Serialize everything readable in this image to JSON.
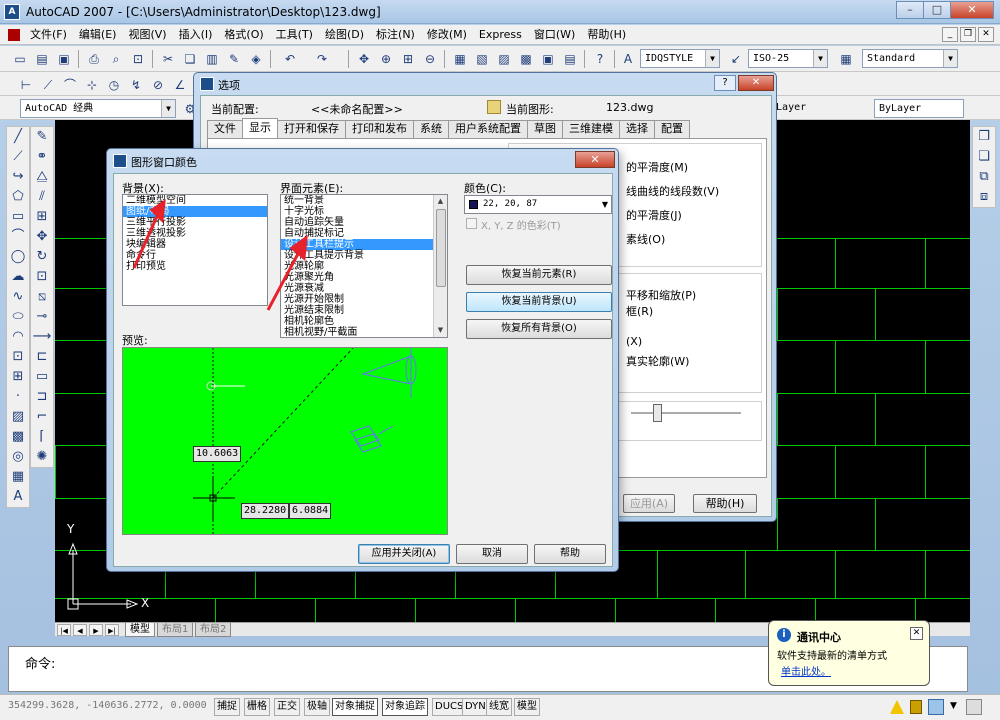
{
  "window": {
    "title": "AutoCAD 2007 - [C:\\Users\\Administrator\\Desktop\\123.dwg]",
    "controls": [
      "–",
      "□",
      "✕"
    ]
  },
  "menubar": {
    "items": [
      "文件(F)",
      "编辑(E)",
      "视图(V)",
      "插入(I)",
      "格式(O)",
      "工具(T)",
      "绘图(D)",
      "标注(N)",
      "修改(M)",
      "Express",
      "窗口(W)",
      "帮助(H)"
    ],
    "mdi_controls": [
      "_",
      "❐",
      "✕"
    ]
  },
  "toolbar": {
    "textstyle": "IDQSTYLE",
    "dimstyle": "ISO-25",
    "tablestyle": "Standard",
    "workspace": "AutoCAD 经典",
    "bylayer1": "ByLayer",
    "bylayer2": "ByLayer"
  },
  "layout_tabs": {
    "nav": [
      "|◀",
      "◀",
      "▶",
      "▶|"
    ],
    "tabs": [
      "模型",
      "布局1",
      "布局2"
    ]
  },
  "command": {
    "prompt": "命令:"
  },
  "status": {
    "coords": "354299.3628, -140636.2772, 0.0000",
    "buttons": [
      "捕捉",
      "栅格",
      "正交",
      "极轴",
      "对象捕捉",
      "对象追踪",
      "DUCS",
      "DYN",
      "线宽",
      "模型"
    ],
    "active": [
      false,
      false,
      false,
      false,
      true,
      true,
      false,
      false,
      false,
      false
    ]
  },
  "balloon": {
    "title": "通讯中心",
    "text": "软件支持最新的清单方式",
    "link": "单击此处。"
  },
  "options_dialog": {
    "title": "选项",
    "help": "?",
    "close": "✕",
    "profile_label": "当前配置:",
    "profile_value": "<<未命名配置>>",
    "drawing_label": "当前图形:",
    "drawing_value": "123.dwg",
    "tabs": [
      "文件",
      "显示",
      "打开和保存",
      "打印和发布",
      "系统",
      "用户系统配置",
      "草图",
      "三维建模",
      "选择",
      "配置"
    ],
    "active_tab": 1,
    "right_texts": [
      "的平滑度(M)",
      "线曲线的线段数(V)",
      "的平滑度(J)",
      "素线(O)",
      "平移和缩放(P)",
      "框(R)",
      "(X)",
      "真实轮廓(W)"
    ],
    "apply": "应用(A)",
    "help_btn": "帮助(H)"
  },
  "color_dialog": {
    "title": "图形窗口颜色",
    "close": "✕",
    "context_label": "背景(X):",
    "contexts": [
      "二维模型空间",
      "图纸/布局",
      "三维平行投影",
      "三维透视投影",
      "块编辑器",
      "命令行",
      "打印预览"
    ],
    "context_selected": 1,
    "element_label": "界面元素(E):",
    "elements": [
      "统一背景",
      "十字光标",
      "自动追踪矢量",
      "自动捕捉标记",
      "设计工具栏提示",
      "设计工具提示背景",
      "光源轮廓",
      "光源聚光角",
      "光源衰减",
      "光源开始限制",
      "光源结束限制",
      "相机轮廓色",
      "相机视野/平截面"
    ],
    "element_selected": 4,
    "color_label": "颜色(C):",
    "color_value": "22, 20, 87",
    "color_hex": "#161457",
    "tint_label": "X, Y, Z 的色彩(T)",
    "restore_element": "恢复当前元素(R)",
    "restore_context": "恢复当前背景(U)",
    "restore_all": "恢复所有背景(O)",
    "preview_label": "预览:",
    "preview_tags": [
      "10.6063",
      "28.2280",
      "6.0884"
    ],
    "apply_close": "应用并关闭(A)",
    "cancel": "取消",
    "help": "帮助"
  },
  "axis": {
    "y": "Y",
    "x": "X"
  },
  "colors": {
    "preview_bg": "#00ff00",
    "grid": "#00c800",
    "selection": "#3399ff",
    "annotation_arrow": "#e8222a"
  },
  "icons": [
    "new-icon",
    "open-icon",
    "save-icon",
    "print-icon",
    "undo-icon",
    "redo-icon",
    "pan-icon",
    "zoom-icon",
    "help-icon",
    "line-icon",
    "circle-icon",
    "arc-icon",
    "move-icon",
    "copy-icon",
    "erase-icon",
    "text-icon"
  ]
}
